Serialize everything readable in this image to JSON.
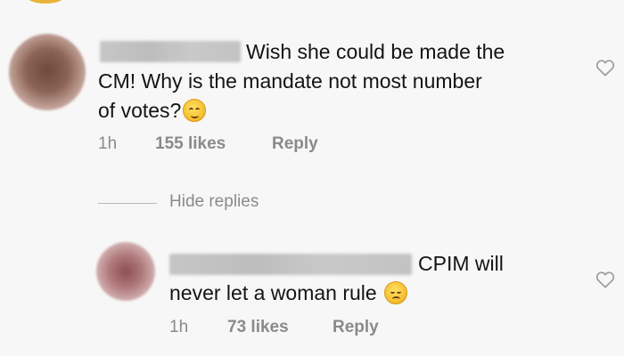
{
  "comments": [
    {
      "text_line1": "Wish she could be made the",
      "text_line2": "CM! Why is the mandate not most number",
      "text_line3": "of votes?",
      "emoji": "relieved-face-emoji",
      "time": "1h",
      "likes": "155 likes",
      "reply_label": "Reply",
      "like_icon": "heart-outline-icon"
    },
    {
      "text_line1": "CPIM will",
      "text_line2": "never let a woman rule",
      "emoji": "disappointed-face-emoji",
      "time": "1h",
      "likes": "73 likes",
      "reply_label": "Reply",
      "like_icon": "heart-outline-icon"
    }
  ],
  "thread": {
    "hide_replies_label": "Hide replies"
  }
}
